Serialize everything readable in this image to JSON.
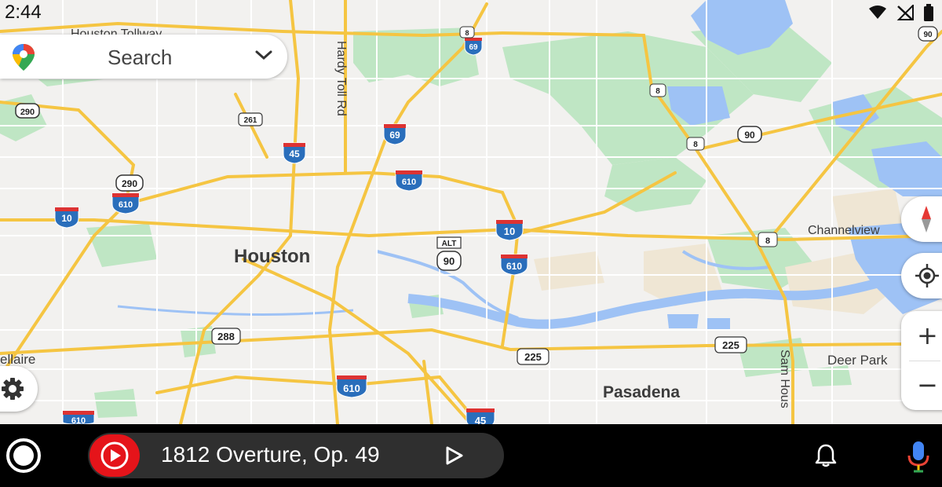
{
  "status_bar": {
    "time": "2:44",
    "icons": [
      "wifi-icon",
      "no-signal-icon",
      "battery-icon"
    ]
  },
  "search": {
    "label": "Search",
    "icon": "maps-pin-icon",
    "chevron": "chevron-down-icon"
  },
  "map": {
    "places": {
      "houston": "Houston",
      "pasadena": "Pasadena",
      "channelview": "Channelview",
      "deer_park": "Deer Park",
      "bellaire": "ellaire"
    },
    "roads": {
      "tollway": "Houston Tollway",
      "hardy": "Hardy Toll Rd",
      "sam_houston": "Sam Hous"
    },
    "shields": {
      "i69_top": "69",
      "i69_mid": "69",
      "i45_top": "45",
      "i45_bottom": "45",
      "i10_left": "10",
      "i10_mid": "10",
      "i610_left": "610",
      "i610_mid": "610",
      "i610_right": "610",
      "i610_bottom": "610",
      "i610_bottomleft": "610",
      "us290_left": "290",
      "us290_mid": "290",
      "us90": "90",
      "us90_right": "90",
      "us90_alt": "ALT",
      "tx261": "261",
      "tx288": "288",
      "tx225_left": "225",
      "tx225_right": "225",
      "tx8_top": "8",
      "tx8_a": "8",
      "tx8_b": "8",
      "tx8_c": "8"
    },
    "colors": {
      "land": "#f2f1ef",
      "park": "#bfe6c4",
      "water": "#9ec2f5",
      "highway": "#f5c542",
      "interstate": "#2a6ebb"
    }
  },
  "controls": {
    "compass": "compass-icon",
    "locate": "my-location-icon",
    "zoom_in": "+",
    "zoom_out": "−",
    "settings": "gear-icon"
  },
  "bottom_bar": {
    "home": "home-circle-icon",
    "media_app": "youtube-music-icon",
    "media_title": "1812 Overture, Op. 49",
    "play": "play-icon",
    "notifications": "bell-icon",
    "assistant": "microphone-icon"
  }
}
